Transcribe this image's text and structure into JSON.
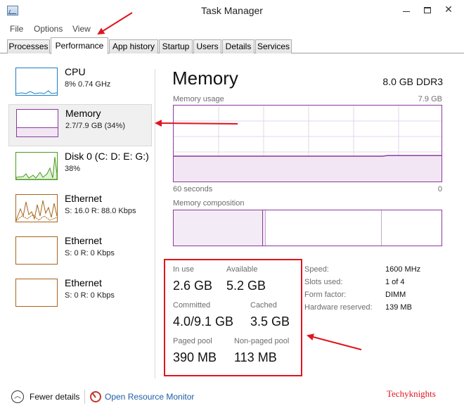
{
  "window": {
    "title": "Task Manager"
  },
  "menu": [
    "File",
    "Options",
    "View"
  ],
  "tabs": [
    "Processes",
    "Performance",
    "App history",
    "Startup",
    "Users",
    "Details",
    "Services"
  ],
  "active_tab": "Performance",
  "sidebar": {
    "items": [
      {
        "name": "CPU",
        "detail": "8% 0.74 GHz",
        "color": "#1b7fc4"
      },
      {
        "name": "Memory",
        "detail": "2.7/7.9 GB (34%)",
        "color": "#8b3a9c"
      },
      {
        "name": "Disk 0 (C: D: E: G:)",
        "detail": "38%",
        "color": "#4a9a1d"
      },
      {
        "name": "Ethernet",
        "detail": "S: 16.0  R: 88.0 Kbps",
        "color": "#a7641b"
      },
      {
        "name": "Ethernet",
        "detail": "S: 0  R: 0 Kbps",
        "color": "#a7641b"
      },
      {
        "name": "Ethernet",
        "detail": "S: 0  R: 0 Kbps",
        "color": "#a7641b"
      }
    ]
  },
  "memory": {
    "heading": "Memory",
    "spec": "8.0 GB DDR3",
    "usage_label": "Memory usage",
    "usage_max": "7.9 GB",
    "time_left": "60 seconds",
    "time_right": "0",
    "composition_label": "Memory composition",
    "usage_fraction": 0.34
  },
  "stats": {
    "in_use_label": "In use",
    "in_use": "2.6 GB",
    "available_label": "Available",
    "available": "5.2 GB",
    "committed_label": "Committed",
    "committed": "4.0/9.1 GB",
    "cached_label": "Cached",
    "cached": "3.5 GB",
    "paged_label": "Paged pool",
    "paged": "390 MB",
    "nonpaged_label": "Non-paged pool",
    "nonpaged": "113 MB"
  },
  "properties": [
    {
      "label": "Speed:",
      "value": "1600 MHz"
    },
    {
      "label": "Slots used:",
      "value": "1 of 4"
    },
    {
      "label": "Form factor:",
      "value": "DIMM"
    },
    {
      "label": "Hardware reserved:",
      "value": "139 MB"
    }
  ],
  "footer": {
    "fewer_details": "Fewer details",
    "resource_monitor": "Open Resource Monitor",
    "watermark": "Techyknights"
  },
  "colors": {
    "memory": "#8b3a9c",
    "annotation": "#e0141e"
  }
}
